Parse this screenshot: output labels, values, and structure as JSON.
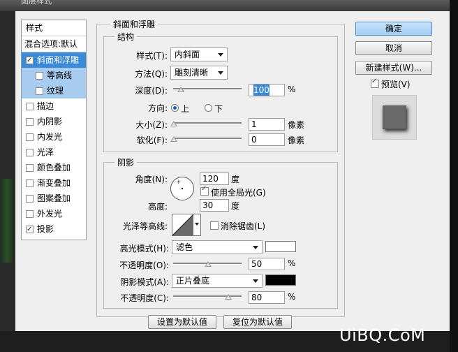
{
  "window": {
    "title": "图层样式"
  },
  "style_list": {
    "header": "样式",
    "blend_options": "混合选项:默认",
    "items": [
      {
        "label": "斜面和浮雕",
        "checked": true,
        "selected": true
      },
      {
        "label": "等高线",
        "checked": false,
        "sub": true
      },
      {
        "label": "纹理",
        "checked": false,
        "sub": true
      },
      {
        "label": "描边",
        "checked": false
      },
      {
        "label": "内阴影",
        "checked": false
      },
      {
        "label": "内发光",
        "checked": false
      },
      {
        "label": "光泽",
        "checked": false
      },
      {
        "label": "颜色叠加",
        "checked": false
      },
      {
        "label": "渐变叠加",
        "checked": false
      },
      {
        "label": "图案叠加",
        "checked": false
      },
      {
        "label": "外发光",
        "checked": false
      },
      {
        "label": "投影",
        "checked": true
      }
    ]
  },
  "bevel": {
    "panel_title": "斜面和浮雕",
    "structure_title": "结构",
    "style_label": "样式(T):",
    "style_value": "内斜面",
    "technique_label": "方法(Q):",
    "technique_value": "雕刻清晰",
    "depth_label": "深度(D):",
    "depth_value": "100",
    "depth_unit": "%",
    "depth_level": 0.1,
    "direction_label": "方向:",
    "direction_up": "上",
    "direction_down": "下",
    "direction_selected": "上",
    "size_label": "大小(Z):",
    "size_value": "1",
    "size_unit": "像素",
    "soften_label": "软化(F):",
    "soften_value": "0",
    "soften_unit": "像素"
  },
  "shading": {
    "title": "阴影",
    "angle_label": "角度(N):",
    "angle_value": "120",
    "angle_unit": "度",
    "global_light_label": "使用全局光(G)",
    "global_light_checked": true,
    "altitude_label": "高度:",
    "altitude_value": "30",
    "altitude_unit": "度",
    "gloss_contour_label": "光泽等高线:",
    "anti_alias_label": "消除锯齿(L)",
    "anti_alias_checked": false,
    "highlight_mode_label": "高光模式(H):",
    "highlight_mode_value": "滤色",
    "highlight_color": "#ffffff",
    "highlight_opacity_label": "不透明度(O):",
    "highlight_opacity_value": "50",
    "highlight_opacity_unit": "%",
    "shadow_mode_label": "阴影模式(A):",
    "shadow_mode_value": "正片叠底",
    "shadow_color": "#000000",
    "shadow_opacity_label": "不透明度(C):",
    "shadow_opacity_value": "80",
    "shadow_opacity_unit": "%"
  },
  "footer": {
    "make_default": "设置为默认值",
    "reset_default": "复位为默认值"
  },
  "right_panel": {
    "ok": "确定",
    "cancel": "取消",
    "new_style": "新建样式(W)...",
    "preview_label": "预览(V)",
    "preview_checked": true
  },
  "watermark": "UiBQ.CoM"
}
